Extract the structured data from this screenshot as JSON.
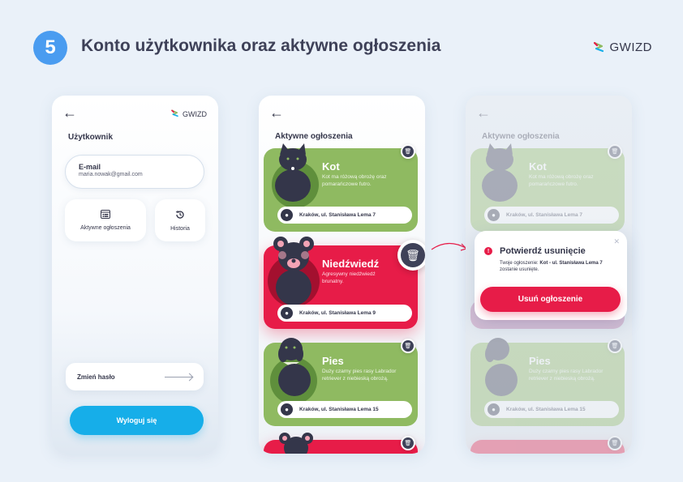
{
  "header": {
    "step_number": "5",
    "title": "Konto użytkownika oraz aktywne ogłoszenia",
    "brand": "GWIZD"
  },
  "colors": {
    "accent_blue": "#4a9cf0",
    "logout_blue": "#16aee9",
    "card_green": "#8fba61",
    "card_red": "#e71c48",
    "dark": "#34364a"
  },
  "account_screen": {
    "back_icon": "arrow-left-icon",
    "brand": "GWIZD",
    "section_title": "Użytkownik",
    "email_label": "E-mail",
    "email_value": "maria.nowak@gmail.com",
    "tiles": [
      {
        "label": "Aktywne ogłoszenia",
        "icon": "list-board-icon"
      },
      {
        "label": "Historia",
        "icon": "history-icon"
      }
    ],
    "change_password_label": "Zmień hasło",
    "logout_label": "Wyloguj się"
  },
  "ads_screen": {
    "back_icon": "arrow-left-icon",
    "section_title": "Aktywne ogłoszenia",
    "cards": [
      {
        "title": "Kot",
        "description": "Kot ma różową obrożę oraz pomarańczowe futro.",
        "address": "Kraków, ul. Stanisława Lema 7",
        "color": "green",
        "pet": "cat"
      },
      {
        "title": "Niedźwiedź",
        "description": "Agresywny niedźwiedź brunatny.",
        "address": "Kraków, ul. Stanisława Lema 9",
        "color": "red",
        "pet": "bear"
      },
      {
        "title": "Pies",
        "description": "Duży czarny pies rasy Labrador retriever z niebieską obrożą.",
        "address": "Kraków, ul. Stanisława Lema 15",
        "color": "green",
        "pet": "dog"
      }
    ]
  },
  "confirm_dialog": {
    "title": "Potwierdź usunięcie",
    "text_prefix": "Twoje ogłoszenie:",
    "text_item": "Kot - ul. Stanisława Lema 7",
    "text_suffix": "zostanie usunięte.",
    "button_label": "Usuń ogłoszenie",
    "close_icon": "close-icon"
  }
}
